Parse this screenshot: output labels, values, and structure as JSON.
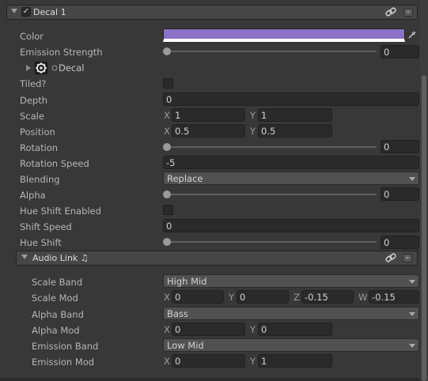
{
  "header": {
    "title": "Decal 1",
    "enabled": true
  },
  "properties": {
    "color": {
      "label": "Color",
      "value": "#8b72c6"
    },
    "emission_strength": {
      "label": "Emission Strength",
      "value": "0",
      "fraction": 0
    },
    "decal": {
      "label": "Decal"
    },
    "tiled": {
      "label": "Tiled?"
    },
    "depth": {
      "label": "Depth",
      "value": "0"
    },
    "scale": {
      "label": "Scale",
      "x_axis": "X",
      "x": "1",
      "y_axis": "Y",
      "y": "1"
    },
    "position": {
      "label": "Position",
      "x_axis": "X",
      "x": "0.5",
      "y_axis": "Y",
      "y": "0.5"
    },
    "rotation": {
      "label": "Rotation",
      "value": "0",
      "fraction": 0
    },
    "rotation_speed": {
      "label": "Rotation Speed",
      "value": "-5"
    },
    "blending": {
      "label": "Blending",
      "value": "Replace"
    },
    "alpha": {
      "label": "Alpha",
      "value": "0",
      "fraction": 0
    },
    "hue_shift_enabled": {
      "label": "Hue Shift Enabled"
    },
    "shift_speed": {
      "label": "Shift Speed",
      "value": "0"
    },
    "hue_shift": {
      "label": "Hue Shift",
      "value": "0",
      "fraction": 0
    }
  },
  "audio_link": {
    "title": "Audio Link ♫",
    "scale_band": {
      "label": "Scale Band",
      "value": "High Mid"
    },
    "scale_mod": {
      "label": "Scale Mod",
      "x_axis": "X",
      "x": "0",
      "y_axis": "Y",
      "y": "0",
      "z_axis": "Z",
      "z": "-0.15",
      "w_axis": "W",
      "w": "-0.15"
    },
    "alpha_band": {
      "label": "Alpha Band",
      "value": "Bass"
    },
    "alpha_mod": {
      "label": "Alpha Mod",
      "x_axis": "X",
      "x": "0",
      "y_axis": "Y",
      "y": "0"
    },
    "emission_band": {
      "label": "Emission Band",
      "value": "Low Mid"
    },
    "emission_mod": {
      "label": "Emission Mod",
      "x_axis": "X",
      "x": "0",
      "y_axis": "Y",
      "y": "1"
    }
  },
  "colors": {
    "panel": "#383838",
    "field": "#2a2a2a",
    "swatch": "#8b72c6"
  }
}
